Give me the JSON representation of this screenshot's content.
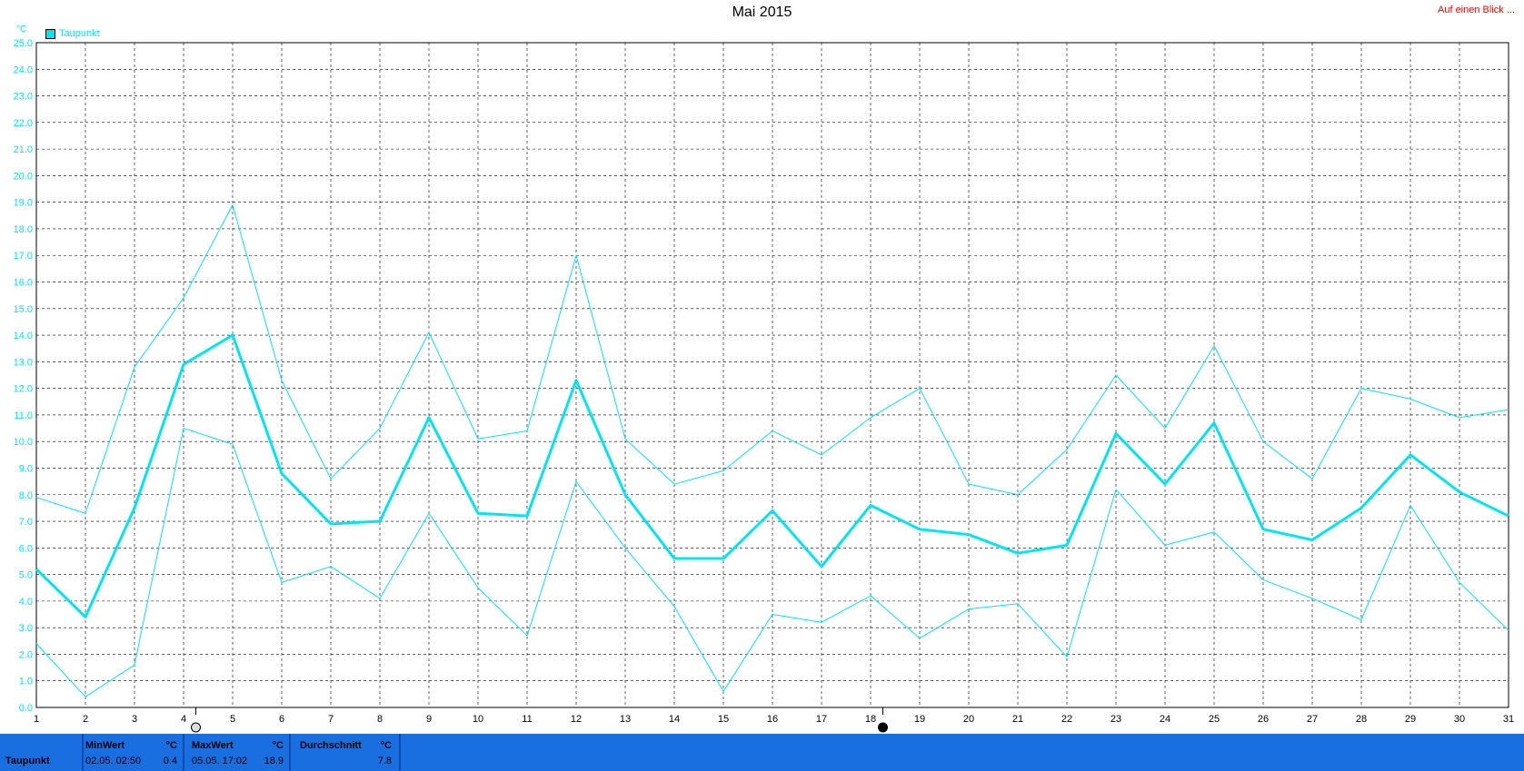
{
  "header": {
    "title": "Mai 2015",
    "glance_link": "Auf einen Blick ..."
  },
  "legend": {
    "label": "Taupunkt",
    "color": "#00e5ee"
  },
  "chart_data": {
    "type": "line",
    "title": "Mai 2015",
    "ylabel": "°C",
    "ylim": [
      0,
      25
    ],
    "yticks": [
      "0.0",
      "1.0",
      "2.0",
      "3.0",
      "4.0",
      "5.0",
      "6.0",
      "7.0",
      "8.0",
      "9.0",
      "10.0",
      "11.0",
      "12.0",
      "13.0",
      "14.0",
      "15.0",
      "16.0",
      "17.0",
      "18.0",
      "19.0",
      "20.0",
      "21.0",
      "22.0",
      "23.0",
      "24.0",
      "25.0"
    ],
    "x": [
      1,
      2,
      3,
      4,
      5,
      6,
      7,
      8,
      9,
      10,
      11,
      12,
      13,
      14,
      15,
      16,
      17,
      18,
      19,
      20,
      21,
      22,
      23,
      24,
      25,
      26,
      27,
      28,
      29,
      30,
      31
    ],
    "grid": true,
    "legend_position": "top-left",
    "series": [
      {
        "name": "Taupunkt",
        "role": "max",
        "width": 1,
        "values": [
          7.9,
          7.3,
          12.8,
          15.4,
          18.9,
          12.3,
          8.6,
          10.5,
          14.1,
          10.1,
          10.4,
          17.0,
          10.1,
          8.4,
          8.9,
          10.4,
          9.5,
          10.9,
          12.0,
          8.4,
          8.0,
          9.7,
          12.5,
          10.5,
          13.6,
          10.0,
          8.6,
          12.0,
          11.6,
          10.9,
          11.2
        ]
      },
      {
        "name": "Taupunkt",
        "role": "mean",
        "width": 3,
        "values": [
          5.2,
          3.4,
          7.5,
          12.9,
          14.0,
          8.8,
          6.9,
          7.0,
          10.9,
          7.3,
          7.2,
          12.3,
          8.0,
          5.6,
          5.6,
          7.4,
          5.3,
          7.6,
          6.7,
          6.5,
          5.8,
          6.1,
          10.3,
          8.4,
          10.7,
          6.7,
          6.3,
          7.5,
          9.5,
          8.1,
          7.2
        ]
      },
      {
        "name": "Taupunkt",
        "role": "min",
        "width": 1,
        "values": [
          2.4,
          0.4,
          1.6,
          10.5,
          9.9,
          4.7,
          5.3,
          4.1,
          7.3,
          4.5,
          2.7,
          8.5,
          6.0,
          3.8,
          0.6,
          3.5,
          3.2,
          4.2,
          2.6,
          3.7,
          3.9,
          1.9,
          8.2,
          6.1,
          6.6,
          4.8,
          4.1,
          3.3,
          7.6,
          4.7,
          2.9
        ]
      }
    ],
    "markers": [
      {
        "x": 4.25,
        "style": "open"
      },
      {
        "x": 18.25,
        "style": "filled"
      }
    ]
  },
  "footer": {
    "row_label": "Taupunkt",
    "min_label": "MinWert",
    "min_unit": "°C",
    "min_time": "02.05.  02:50",
    "min_value": "0.4",
    "max_label": "MaxWert",
    "max_unit": "°C",
    "max_time": "05.05.  17:02",
    "max_value": "18.9",
    "avg_label": "Durchschnitt",
    "avg_unit": "°C",
    "avg_value": "7.8"
  }
}
